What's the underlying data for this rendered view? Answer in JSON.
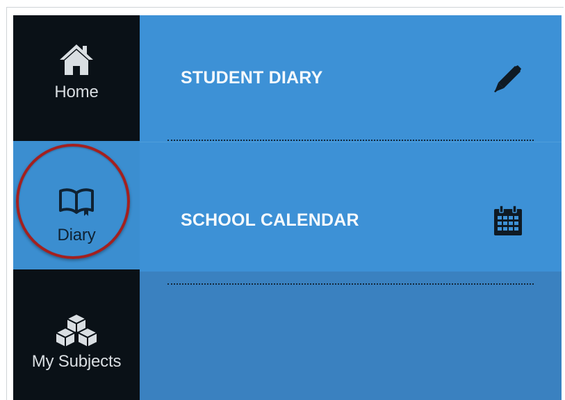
{
  "sidebar": {
    "items": [
      {
        "label": "Home",
        "icon": "home-icon"
      },
      {
        "label": "Diary",
        "icon": "book-icon",
        "active": true
      },
      {
        "label": "My Subjects",
        "icon": "cubes-icon"
      }
    ]
  },
  "menu": {
    "items": [
      {
        "label": "STUDENT DIARY",
        "icon": "pen-icon"
      },
      {
        "label": "SCHOOL CALENDAR",
        "icon": "calendar-icon"
      }
    ]
  },
  "colors": {
    "sidebar_bg": "#0a1117",
    "active_bg": "#3b8ed0",
    "menu_bg": "#3d91d6",
    "panel_bg": "#3a81c0",
    "highlight": "#a3201f"
  }
}
